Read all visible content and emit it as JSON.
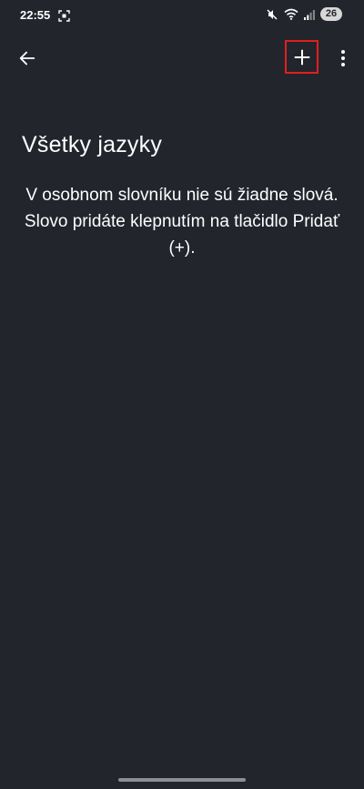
{
  "status_bar": {
    "time": "22:55",
    "battery_level": "26",
    "icons": [
      "screenshot-icon",
      "mute-icon",
      "wifi-icon",
      "signal-icon",
      "battery-icon"
    ]
  },
  "toolbar": {
    "back_icon": "arrow-back-icon",
    "add_icon": "plus-icon",
    "more_icon": "more-vert-icon",
    "highlight_color": "#e0201c"
  },
  "main": {
    "title": "Všetky jazyky",
    "empty_message": "V osobnom slovníku nie sú žiadne slová. Slovo pridáte klepnutím na tlačidlo Pridať (+)."
  },
  "colors": {
    "background": "#23252d",
    "text": "#ffffff"
  }
}
